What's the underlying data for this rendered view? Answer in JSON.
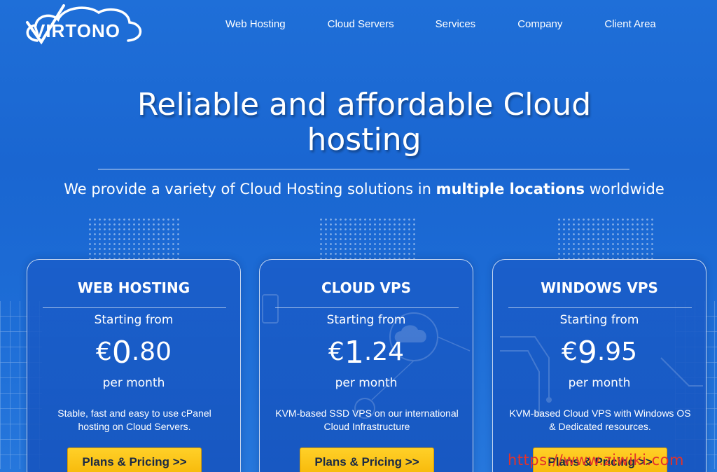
{
  "brand": {
    "name": "VIRTONO",
    "logo_icon": "cloud-logo-icon"
  },
  "nav": {
    "items": [
      {
        "label": "Web Hosting"
      },
      {
        "label": "Cloud Servers"
      },
      {
        "label": "Services"
      },
      {
        "label": "Company"
      },
      {
        "label": "Client Area"
      }
    ]
  },
  "hero": {
    "title": "Reliable and affordable Cloud hosting",
    "subtitle_prefix": "We provide a variety of Cloud Hosting solutions in ",
    "subtitle_bold": "multiple locations",
    "subtitle_suffix": " worldwide"
  },
  "cards": [
    {
      "title": "WEB HOSTING",
      "starting": "Starting from",
      "currency": "€",
      "price_int": "0",
      "price_dec": ".80",
      "period": "per month",
      "description": "Stable, fast and easy to use cPanel hosting on Cloud Servers.",
      "button": "Plans & Pricing >>"
    },
    {
      "title": "CLOUD VPS",
      "starting": "Starting from",
      "currency": "€",
      "price_int": "1",
      "price_dec": ".24",
      "period": "per month",
      "description": "KVM-based SSD VPS on our international Cloud Infrastructure",
      "button": "Plans & Pricing >>"
    },
    {
      "title": "WINDOWS VPS",
      "starting": "Starting from",
      "currency": "€",
      "price_int": "9",
      "price_dec": ".95",
      "period": "per month",
      "description": "KVM-based Cloud VPS with Windows OS & Dedicated resources.",
      "button": "Plans & Pricing >>"
    }
  ],
  "watermark": "https://www.ziwiki.com",
  "colors": {
    "background": "#1c6bd5",
    "button": "#f7b90a",
    "watermark": "#e3322b"
  }
}
